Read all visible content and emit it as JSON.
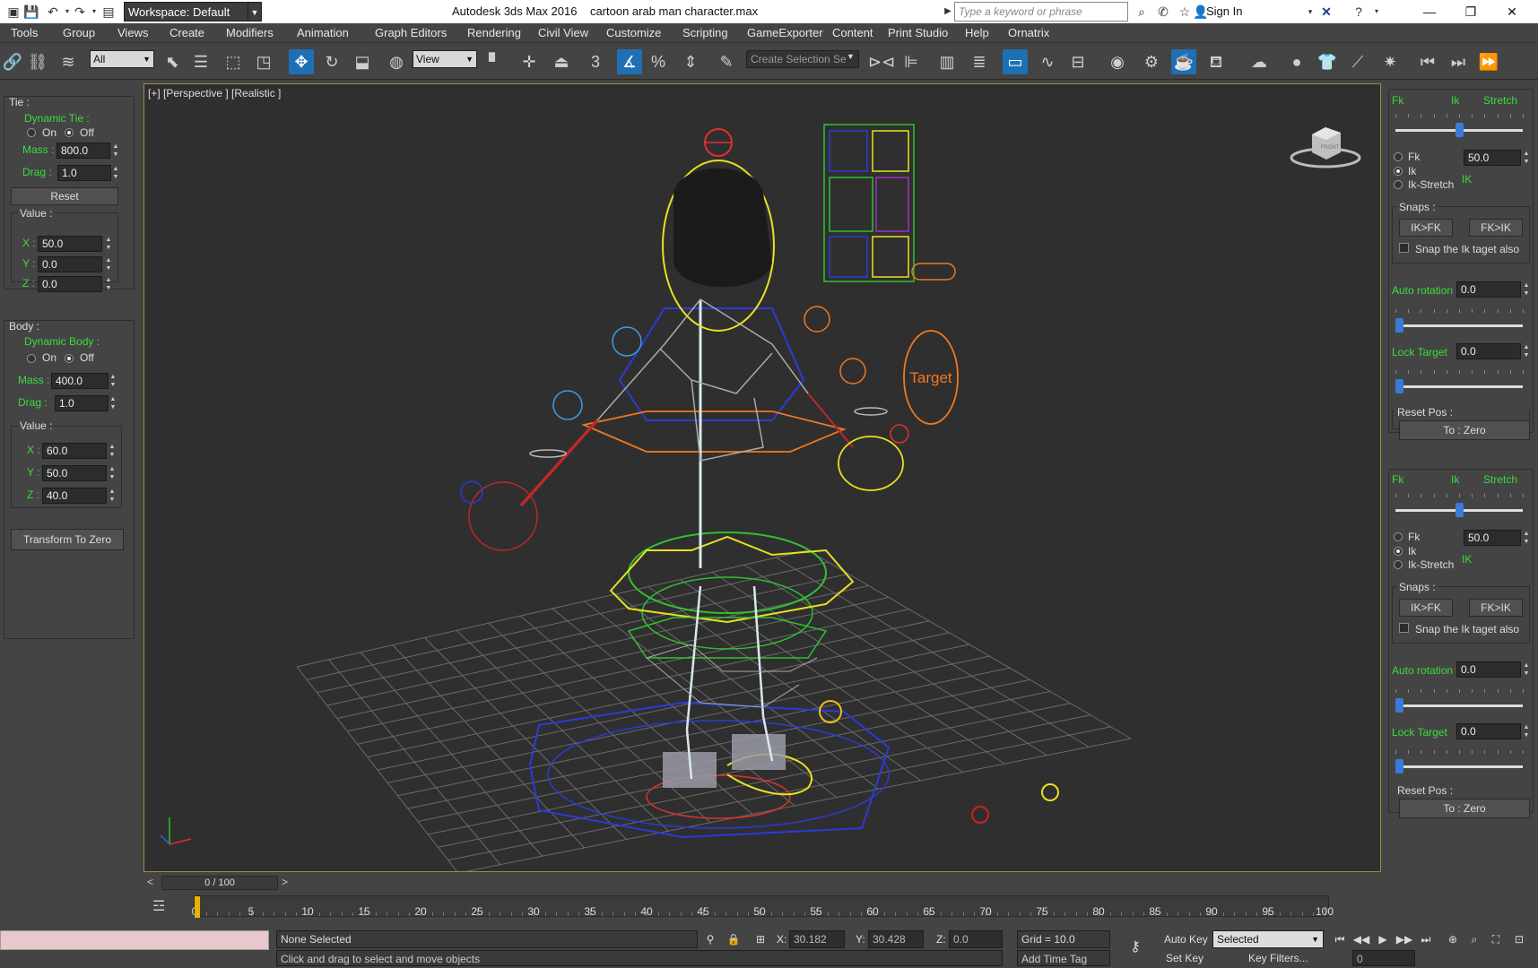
{
  "titlebar": {
    "workspace": "Workspace: Default",
    "app_name": "Autodesk 3ds Max 2016",
    "file_name": "cartoon arab man character.max",
    "search_placeholder": "Type a keyword or phrase",
    "sign_in": "Sign In"
  },
  "menu": [
    "Tools",
    "Group",
    "Views",
    "Create",
    "Modifiers",
    "Animation",
    "Graph Editors",
    "Rendering",
    "Civil View",
    "Customize",
    "Scripting",
    "GameExporter",
    "Content",
    "Print Studio",
    "Help",
    "Ornatrix"
  ],
  "toolbar": {
    "filter": "All",
    "ref_coord": "View",
    "snap_value": "3",
    "selection_set": "Create Selection Se"
  },
  "left_panel": {
    "tie": {
      "title": "Tie :",
      "dynamic": "Dynamic Tie :",
      "on": "On",
      "off": "Off",
      "mass_label": "Mass :",
      "mass": "800.0",
      "drag_label": "Drag :",
      "drag": "1.0",
      "reset": "Reset",
      "value_label": "Value :",
      "x_label": "X :",
      "x": "50.0",
      "y_label": "Y :",
      "y": "0.0",
      "z_label": "Z :",
      "z": "0.0"
    },
    "body": {
      "title": "Body :",
      "dynamic": "Dynamic Body :",
      "on": "On",
      "off": "Off",
      "mass_label": "Mass :",
      "mass": "400.0",
      "drag_label": "Drag :",
      "drag": "1.0",
      "value_label": "Value :",
      "x_label": "X :",
      "x": "60.0",
      "y_label": "Y :",
      "y": "50.0",
      "z_label": "Z :",
      "z": "40.0",
      "transform": "Transform To Zero"
    }
  },
  "viewport": {
    "label": "[+] [Perspective ] [Realistic ]",
    "target_text": "Target",
    "viewcube_label": "FRONT"
  },
  "right_panel": {
    "blocks": [
      {
        "fk": "Fk",
        "ik": "Ik",
        "stretch": "Stretch",
        "blend": 0.5,
        "radio_fk": "Fk",
        "radio_ik": "Ik",
        "radio_ikstretch": "Ik-Stretch",
        "value": "50.0",
        "mode_tag": "IK",
        "snaps_label": "Snaps :",
        "ik_fk": "IK>FK",
        "fk_ik": "FK>IK",
        "snap_target": "Snap the Ik taget also",
        "auto_rotation": "Auto rotation",
        "auto_rotation_value": "0.0",
        "lock_target": "Lock Target",
        "lock_target_value": "0.0",
        "reset_pos": "Reset Pos :",
        "to_zero": "To : Zero"
      },
      {
        "fk": "Fk",
        "ik": "Ik",
        "stretch": "Stretch",
        "blend": 0.5,
        "radio_fk": "Fk",
        "radio_ik": "Ik",
        "radio_ikstretch": "Ik-Stretch",
        "value": "50.0",
        "mode_tag": "IK",
        "snaps_label": "Snaps :",
        "ik_fk": "IK>FK",
        "fk_ik": "FK>IK",
        "snap_target": "Snap the Ik taget also",
        "auto_rotation": "Auto rotation",
        "auto_rotation_value": "0.0",
        "lock_target": "Lock Target",
        "lock_target_value": "0.0",
        "reset_pos": "Reset Pos :",
        "to_zero": "To : Zero"
      }
    ]
  },
  "timeline": {
    "frame_display": "0 / 100",
    "ticks": [
      "0",
      "5",
      "10",
      "15",
      "20",
      "25",
      "30",
      "35",
      "40",
      "45",
      "50",
      "55",
      "60",
      "65",
      "70",
      "75",
      "80",
      "85",
      "90",
      "95",
      "100"
    ]
  },
  "status": {
    "selection": "None Selected",
    "prompt": "Click and drag to select and move objects",
    "x_label": "X:",
    "x": "30.182",
    "y_label": "Y:",
    "y": "30.428",
    "z_label": "Z:",
    "z": "0.0",
    "grid": "Grid = 10.0",
    "add_time_tag": "Add Time Tag",
    "auto_key": "Auto Key",
    "set_key": "Set Key",
    "key_mode": "Selected",
    "key_filters": "Key Filters...",
    "frame": "0"
  },
  "colors": {
    "viewport_border": "#a38a3e",
    "accent_blue": "#1f6fb5",
    "green_label": "#3bdc3b"
  }
}
